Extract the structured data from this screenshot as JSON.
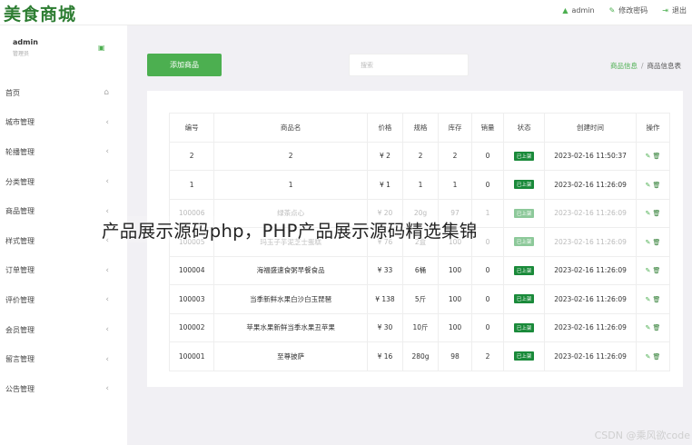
{
  "header": {
    "logo": "美食商城",
    "user": "admin",
    "change_password": "修改密码",
    "logout": "退出"
  },
  "profile": {
    "name": "admin",
    "role": "管理员"
  },
  "sidebar": {
    "items": [
      {
        "label": "首页",
        "icon": "home-icon"
      },
      {
        "label": "城市管理",
        "icon": "chevron-left-icon"
      },
      {
        "label": "轮播管理",
        "icon": "chevron-left-icon"
      },
      {
        "label": "分类管理",
        "icon": "chevron-left-icon"
      },
      {
        "label": "商品管理",
        "icon": "chevron-left-icon"
      },
      {
        "label": "样式管理",
        "icon": "chevron-left-icon"
      },
      {
        "label": "订单管理",
        "icon": "chevron-left-icon"
      },
      {
        "label": "评价管理",
        "icon": "chevron-left-icon"
      },
      {
        "label": "会员管理",
        "icon": "chevron-left-icon"
      },
      {
        "label": "留言管理",
        "icon": "chevron-left-icon"
      },
      {
        "label": "公告管理",
        "icon": "chevron-left-icon"
      }
    ]
  },
  "toolbar": {
    "add_label": "添加商品",
    "search_placeholder": "搜索"
  },
  "breadcrumb": {
    "parent": "商品信息",
    "separator": "/",
    "current": "商品信息表"
  },
  "table": {
    "headers": [
      "编号",
      "商品名",
      "价格",
      "规格",
      "库存",
      "销量",
      "状态",
      "创建时间",
      "操作"
    ],
    "rows": [
      {
        "id": "2",
        "name": "2",
        "price": "¥ 2",
        "spec": "2",
        "stock": "2",
        "sales": "0",
        "status": "已上架",
        "created": "2023-02-16 11:50:37"
      },
      {
        "id": "1",
        "name": "1",
        "price": "¥ 1",
        "spec": "1",
        "stock": "1",
        "sales": "0",
        "status": "已上架",
        "created": "2023-02-16 11:26:09"
      },
      {
        "id": "100006",
        "name": "绿茶点心",
        "price": "¥ 20",
        "spec": "20g",
        "stock": "97",
        "sales": "1",
        "status": "已上架",
        "created": "2023-02-16 11:26:09"
      },
      {
        "id": "100005",
        "name": "玛玉子芋泥芝士蛋糕",
        "price": "¥ 76",
        "spec": "2盒",
        "stock": "100",
        "sales": "0",
        "status": "已上架",
        "created": "2023-02-16 11:26:09"
      },
      {
        "id": "100004",
        "name": "海福盛速食粥早餐食品",
        "price": "¥ 33",
        "spec": "6桶",
        "stock": "100",
        "sales": "0",
        "status": "已上架",
        "created": "2023-02-16 11:26:09"
      },
      {
        "id": "100003",
        "name": "当季新鲜水果白沙白玉琵琶",
        "price": "¥ 138",
        "spec": "5斤",
        "stock": "100",
        "sales": "0",
        "status": "已上架",
        "created": "2023-02-16 11:26:09"
      },
      {
        "id": "100002",
        "name": "苹果水果新鲜当季水果丑苹果",
        "price": "¥ 30",
        "spec": "10斤",
        "stock": "100",
        "sales": "0",
        "status": "已上架",
        "created": "2023-02-16 11:26:09"
      },
      {
        "id": "100001",
        "name": "至尊披萨",
        "price": "¥ 16",
        "spec": "280g",
        "stock": "98",
        "sales": "2",
        "status": "已上架",
        "created": "2023-02-16 11:26:09"
      }
    ]
  },
  "overlay": {
    "title": "产品展示源码php，PHP产品展示源码精选集锦",
    "credit": "CSDN @乘风欲code"
  },
  "colors": {
    "accent": "#4caf50",
    "badge": "#1a8a3a"
  }
}
